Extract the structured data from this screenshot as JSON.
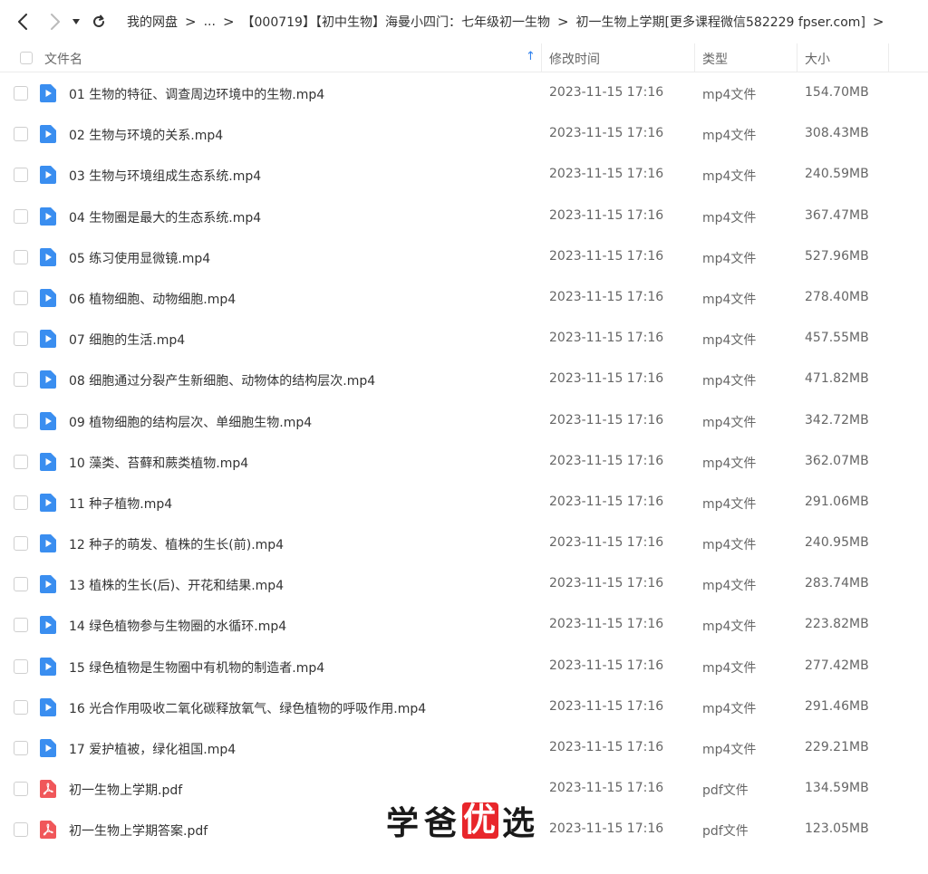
{
  "breadcrumb": {
    "items": [
      "我的网盘",
      "...",
      "【000719】【初中生物】海曼小四门：七年级初一生物",
      "初一生物上学期[更多课程微信582229 fpser.com]"
    ],
    "separator": ">"
  },
  "header": {
    "name": "文件名",
    "mtime": "修改时间",
    "type": "类型",
    "size": "大小"
  },
  "files": [
    {
      "name": "01 生物的特征、调查周边环境中的生物.mp4",
      "mtime": "2023-11-15 17:16",
      "type": "mp4文件",
      "size": "154.70MB",
      "icon": "video-file-icon"
    },
    {
      "name": "02 生物与环境的关系.mp4",
      "mtime": "2023-11-15 17:16",
      "type": "mp4文件",
      "size": "308.43MB",
      "icon": "video-file-icon"
    },
    {
      "name": "03 生物与环境组成生态系统.mp4",
      "mtime": "2023-11-15 17:16",
      "type": "mp4文件",
      "size": "240.59MB",
      "icon": "video-file-icon"
    },
    {
      "name": "04 生物圈是最大的生态系统.mp4",
      "mtime": "2023-11-15 17:16",
      "type": "mp4文件",
      "size": "367.47MB",
      "icon": "video-file-icon"
    },
    {
      "name": "05 练习使用显微镜.mp4",
      "mtime": "2023-11-15 17:16",
      "type": "mp4文件",
      "size": "527.96MB",
      "icon": "video-file-icon"
    },
    {
      "name": "06 植物细胞、动物细胞.mp4",
      "mtime": "2023-11-15 17:16",
      "type": "mp4文件",
      "size": "278.40MB",
      "icon": "video-file-icon"
    },
    {
      "name": "07 细胞的生活.mp4",
      "mtime": "2023-11-15 17:16",
      "type": "mp4文件",
      "size": "457.55MB",
      "icon": "video-file-icon"
    },
    {
      "name": "08 细胞通过分裂产生新细胞、动物体的结构层次.mp4",
      "mtime": "2023-11-15 17:16",
      "type": "mp4文件",
      "size": "471.82MB",
      "icon": "video-file-icon"
    },
    {
      "name": "09 植物细胞的结构层次、单细胞生物.mp4",
      "mtime": "2023-11-15 17:16",
      "type": "mp4文件",
      "size": "342.72MB",
      "icon": "video-file-icon"
    },
    {
      "name": "10 藻类、苔藓和蕨类植物.mp4",
      "mtime": "2023-11-15 17:16",
      "type": "mp4文件",
      "size": "362.07MB",
      "icon": "video-file-icon"
    },
    {
      "name": "11 种子植物.mp4",
      "mtime": "2023-11-15 17:16",
      "type": "mp4文件",
      "size": "291.06MB",
      "icon": "video-file-icon"
    },
    {
      "name": "12 种子的萌发、植株的生长(前).mp4",
      "mtime": "2023-11-15 17:16",
      "type": "mp4文件",
      "size": "240.95MB",
      "icon": "video-file-icon"
    },
    {
      "name": "13 植株的生长(后)、开花和结果.mp4",
      "mtime": "2023-11-15 17:16",
      "type": "mp4文件",
      "size": "283.74MB",
      "icon": "video-file-icon"
    },
    {
      "name": "14 绿色植物参与生物圈的水循环.mp4",
      "mtime": "2023-11-15 17:16",
      "type": "mp4文件",
      "size": "223.82MB",
      "icon": "video-file-icon"
    },
    {
      "name": "15 绿色植物是生物圈中有机物的制造者.mp4",
      "mtime": "2023-11-15 17:16",
      "type": "mp4文件",
      "size": "277.42MB",
      "icon": "video-file-icon"
    },
    {
      "name": "16 光合作用吸收二氧化碳释放氧气、绿色植物的呼吸作用.mp4",
      "mtime": "2023-11-15 17:16",
      "type": "mp4文件",
      "size": "291.46MB",
      "icon": "video-file-icon"
    },
    {
      "name": "17 爱护植被，绿化祖国.mp4",
      "mtime": "2023-11-15 17:16",
      "type": "mp4文件",
      "size": "229.21MB",
      "icon": "video-file-icon"
    },
    {
      "name": "初一生物上学期.pdf",
      "mtime": "2023-11-15 17:16",
      "type": "pdf文件",
      "size": "134.59MB",
      "icon": "pdf-file-icon"
    },
    {
      "name": "初一生物上学期答案.pdf",
      "mtime": "2023-11-15 17:16",
      "type": "pdf文件",
      "size": "123.05MB",
      "icon": "pdf-file-icon"
    }
  ],
  "watermark": [
    "学",
    "爸",
    "优",
    "选"
  ],
  "colors": {
    "video_icon": "#3a8ef0",
    "pdf_icon": "#f0575a",
    "sort_arrow": "#2f80ed",
    "watermark_red": "#e8262b"
  }
}
